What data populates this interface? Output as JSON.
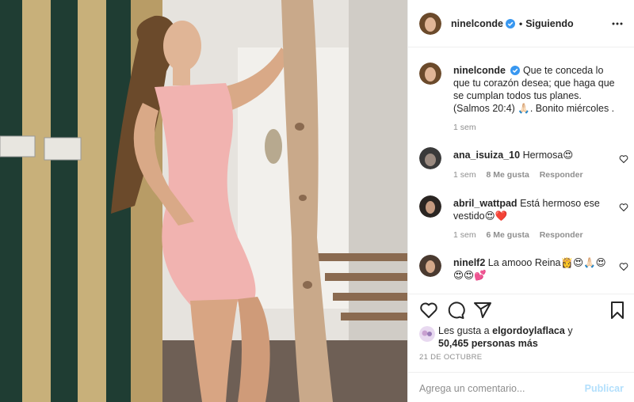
{
  "post": {
    "username": "ninelconde",
    "follow_status": "Siguiendo",
    "caption_user": "ninelconde",
    "caption_text": "Que te conceda lo que tu corazón desea; que haga que se cumplan todos tus planes. (Salmos 20:4) 🙏🏻. Bonito miércoles .",
    "caption_time": "1 sem"
  },
  "comments": [
    {
      "user": "ana_isuiza_10",
      "text": "Hermosa😍",
      "time": "1 sem",
      "likes": "8 Me gusta",
      "reply": "Responder"
    },
    {
      "user": "abril_wattpad",
      "text": "Está hermoso ese vestido😍❤️",
      "time": "1 sem",
      "likes": "6 Me gusta",
      "reply": "Responder"
    },
    {
      "user": "ninelf2",
      "text": "La amooo Reina👸😍🙏🏻😍😍😍💕"
    }
  ],
  "likes": {
    "prefix": "Les gusta a",
    "user": "elgordoylaflaca",
    "connector": "y",
    "count": "50,465 personas más"
  },
  "date": "21 DE OCTUBRE",
  "add_comment": {
    "placeholder": "Agrega un comentario...",
    "publish": "Publicar"
  },
  "colors": {
    "verified": "#3897f0",
    "publish_disabled": "#b2dffc",
    "dress": "#f1b3b0"
  }
}
